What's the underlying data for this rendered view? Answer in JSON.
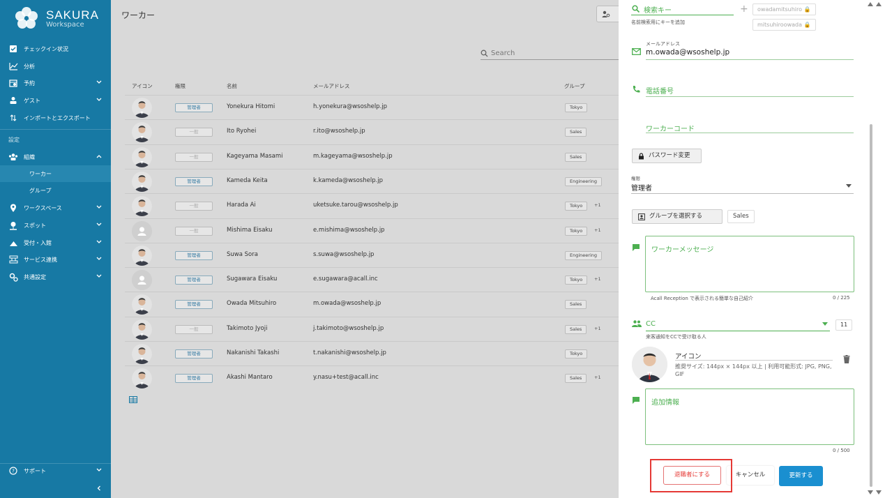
{
  "brand": {
    "name": "SAKURA",
    "sub": "Workspace"
  },
  "sidebar": {
    "items": [
      {
        "label": "チェックイン状況",
        "icon": "checkbox-icon"
      },
      {
        "label": "分析",
        "icon": "chart-icon"
      },
      {
        "label": "予約",
        "icon": "calendar-icon",
        "chevron": "down"
      },
      {
        "label": "ゲスト",
        "icon": "guest-icon",
        "chevron": "down"
      },
      {
        "label": "インポートとエクスポート",
        "icon": "import-export-icon"
      }
    ],
    "section_label": "設定",
    "settings_items": [
      {
        "label": "組織",
        "icon": "org-icon",
        "chevron": "up"
      },
      {
        "label": "ワーカー",
        "active": true
      },
      {
        "label": "グループ"
      },
      {
        "label": "ワークスペース",
        "icon": "pin-icon",
        "chevron": "down"
      },
      {
        "label": "スポット",
        "icon": "spot-icon",
        "chevron": "down"
      },
      {
        "label": "受付・入館",
        "icon": "reception-icon",
        "chevron": "down"
      },
      {
        "label": "サービス連携",
        "icon": "integration-icon",
        "chevron": "down"
      },
      {
        "label": "共通設定",
        "icon": "gears-icon",
        "chevron": "down"
      }
    ],
    "support": "サポート"
  },
  "main": {
    "title": "ワーカー",
    "search_placeholder": "Search",
    "columns": [
      "アイコン",
      "権限",
      "名前",
      "メールアドレス",
      "グループ"
    ],
    "rows": [
      {
        "role": "管理者",
        "name": "Yonekura Hitomi",
        "email": "h.yonekura@wsoshelp.jp",
        "group": "Tokyo",
        "extra": "",
        "photo": true
      },
      {
        "role": "一般",
        "name": "Ito Ryohei",
        "email": "r.ito@wsoshelp.jp",
        "group": "Sales",
        "extra": "",
        "photo": true
      },
      {
        "role": "一般",
        "name": "Kageyama Masami",
        "email": "m.kageyama@wsoshelp.jp",
        "group": "Sales",
        "extra": "",
        "photo": true
      },
      {
        "role": "管理者",
        "name": "Kameda Keita",
        "email": "k.kameda@wsoshelp.jp",
        "group": "Engineering",
        "extra": "",
        "photo": true
      },
      {
        "role": "一般",
        "name": "Harada Ai",
        "email": "uketsuke.tarou@wsoshelp.jp",
        "group": "Tokyo",
        "extra": "+1",
        "photo": true
      },
      {
        "role": "一般",
        "name": "Mishima Eisaku",
        "email": "e.mishima@wsoshelp.jp",
        "group": "Tokyo",
        "extra": "+1",
        "photo": false
      },
      {
        "role": "管理者",
        "name": "Suwa Sora",
        "email": "s.suwa@wsoshelp.jp",
        "group": "Engineering",
        "extra": "",
        "photo": true
      },
      {
        "role": "管理者",
        "name": "Sugawara Eisaku",
        "email": "e.sugawara@acall.inc",
        "group": "Tokyo",
        "extra": "+1",
        "photo": false
      },
      {
        "role": "管理者",
        "name": "Owada Mitsuhiro",
        "email": "m.owada@wsoshelp.jp",
        "group": "Sales",
        "extra": "",
        "photo": true
      },
      {
        "role": "一般",
        "name": "Takimoto Jyoji",
        "email": "j.takimoto@wsoshelp.jp",
        "group": "Sales",
        "extra": "+1",
        "photo": true
      },
      {
        "role": "管理者",
        "name": "Nakanishi Takashi",
        "email": "t.nakanishi@wsoshelp.jp",
        "group": "Tokyo",
        "extra": "",
        "photo": true
      },
      {
        "role": "管理者",
        "name": "Akashi Mantaro",
        "email": "y.nasu+test@acall.inc",
        "group": "Sales",
        "extra": "+1",
        "photo": true
      }
    ]
  },
  "panel": {
    "search_key_label": "検索キー",
    "search_key_help": "名前検索用にキーを追加",
    "keys": [
      "owadamitsuhiro",
      "mitsuhiroowada"
    ],
    "email_label": "メールアドレス",
    "email_value": "m.owada@wsoshelp.jp",
    "phone_label": "電話番号",
    "worker_code_label": "ワーカーコード",
    "password_button": "パスワード変更",
    "role_label": "権限",
    "role_value": "管理者",
    "group_button": "グループを選択する",
    "group_chip": "Sales",
    "message_label": "ワーカーメッセージ",
    "message_help": "Acall Reception で表示される簡単な自己紹介",
    "message_count": "0 / 225",
    "cc_label": "CC",
    "cc_count": "11",
    "cc_help": "来客通知をCCで受け取る人",
    "icon_label": "アイコン",
    "icon_help": "推奨サイズ: 144px × 144px 以上 | 利用可能形式: JPG, PNG, GIF",
    "extra_label": "追加情報",
    "extra_count": "0 / 500",
    "retire_button": "退職者にする",
    "cancel_button": "キャンセル",
    "update_button": "更新する"
  },
  "colors": {
    "sidebar": "#1779a4",
    "accent_green": "#4caf50",
    "primary": "#1a8fd0",
    "danger": "#e53935"
  }
}
